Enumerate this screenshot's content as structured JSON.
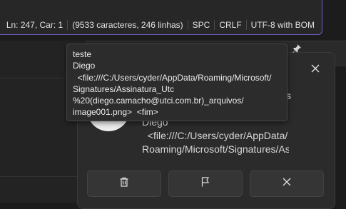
{
  "statusbar": {
    "position": "Ln: 247, Car: 1",
    "stats": "(9533 caracteres, 246 linhas)",
    "indent": "SPC",
    "line_ending": "CRLF",
    "encoding": "UTF-8 with BOM"
  },
  "tooltip": {
    "lines": [
      "teste",
      "Diego",
      "  <file:///C:/Users/cyder/AppData/Roaming/Microsoft/",
      "Signatures/Assinatura_Utc",
      "%20(diego.camacho@utci.com.br)_arquivos/",
      "image001.png>  <fim>"
    ]
  },
  "notification": {
    "partial_s": "s",
    "body_lines": [
      "Diego",
      "  <file:///C:/Users/cyder/AppData/",
      "Roaming/Microsoft/Signatures/Assinatura"
    ]
  },
  "icons": {
    "pin": "pin-icon",
    "close": "close-icon",
    "delete": "trash-icon",
    "flag": "flag-icon",
    "dismiss": "close-icon"
  },
  "colors": {
    "accent_border": "#6b5fbf",
    "card_bg": "#2b2b2b",
    "tooltip_bg": "#2c2c2c"
  }
}
